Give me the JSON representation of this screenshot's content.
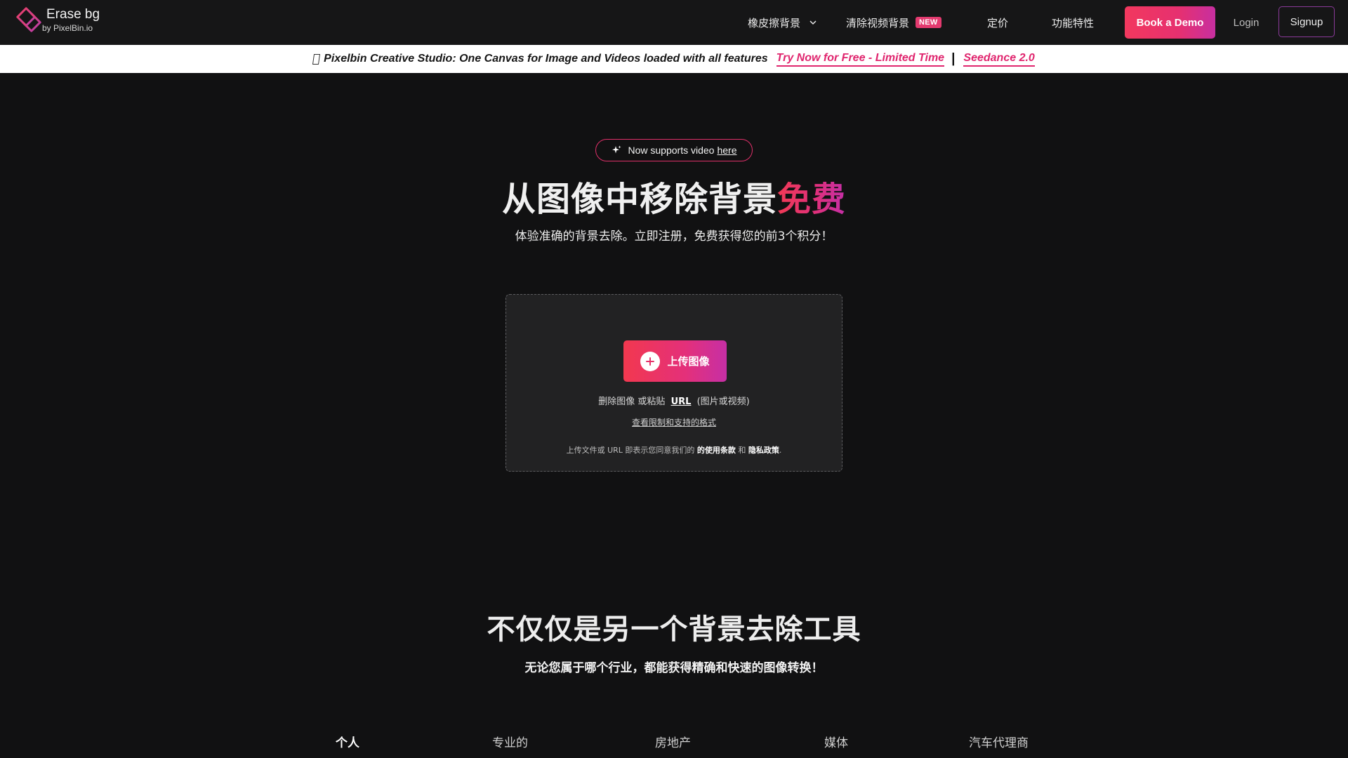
{
  "brand": {
    "name": "Erase bg",
    "sub": "by PixelBin.io",
    "color_primary": "#e0306a",
    "color_secondary": "#c42fa8"
  },
  "nav": {
    "items": [
      {
        "label": "橡皮擦背景",
        "has_dropdown": true
      },
      {
        "label": "清除视频背景",
        "badge": "NEW"
      },
      {
        "label": "定价"
      },
      {
        "label": "功能特性"
      }
    ],
    "demo_label": "Book a Demo",
    "login_label": "Login",
    "signup_label": "Signup"
  },
  "banner": {
    "text": "Pixelbin Creative Studio: One Canvas for Image and Videos loaded with all features",
    "cta": "Try Now for Free - Limited Time",
    "separator": "|",
    "link2": "Seedance 2.0"
  },
  "hero": {
    "pill_text": "Now supports video",
    "pill_link": "here",
    "title_main": "从图像中移除背景",
    "title_accent": "免费",
    "subtitle": "体验准确的背景去除。立即注册，免费获得您的前3个积分！"
  },
  "upload": {
    "button_label": "上传图像",
    "drop_text": "删除图像 或粘贴",
    "url_label": "URL",
    "drop_suffix": "(图片或视频)",
    "limits_link": "查看限制和支持的格式",
    "terms_prefix": "上传文件或 URL 即表示您同意我们的",
    "terms_link": "的使用条款",
    "terms_and": "和",
    "privacy_link": "隐私政策",
    "terms_suffix": "."
  },
  "section": {
    "title": "不仅仅是另一个背景去除工具",
    "subtitle": "无论您属于哪个行业，都能获得精确和快速的图像转换！",
    "tabs": [
      "个人",
      "专业的",
      "房地产",
      "媒体",
      "汽车代理商"
    ]
  }
}
